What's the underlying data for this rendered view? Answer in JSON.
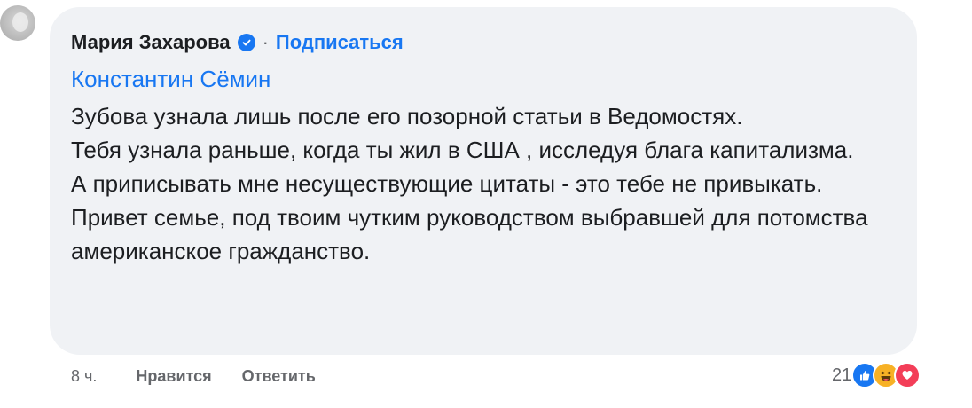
{
  "comment": {
    "author": "Мария Захарова",
    "separator": "·",
    "subscribe_label": "Подписаться",
    "mention": "Константин Сёмин",
    "paragraphs": [
      "Зубова узнала лишь после его позорной статьи в Ведомостях.",
      "Тебя узнала раньше, когда ты жил  в США , исследуя  блага капитализма.",
      "А приписывать мне несуществующие цитаты - это тебе не привыкать. Привет семье, под твоим чутким руководством выбравшей для потомства американское гражданство."
    ]
  },
  "footer": {
    "time": "8 ч.",
    "like_label": "Нравится",
    "reply_label": "Ответить"
  },
  "reactions": {
    "count": "21",
    "icons": [
      "like-icon",
      "haha-icon",
      "love-icon"
    ]
  },
  "colors": {
    "bubble": "#f0f2f5",
    "accent": "#1877f2",
    "text": "#1c1e21",
    "muted": "#65676b"
  }
}
